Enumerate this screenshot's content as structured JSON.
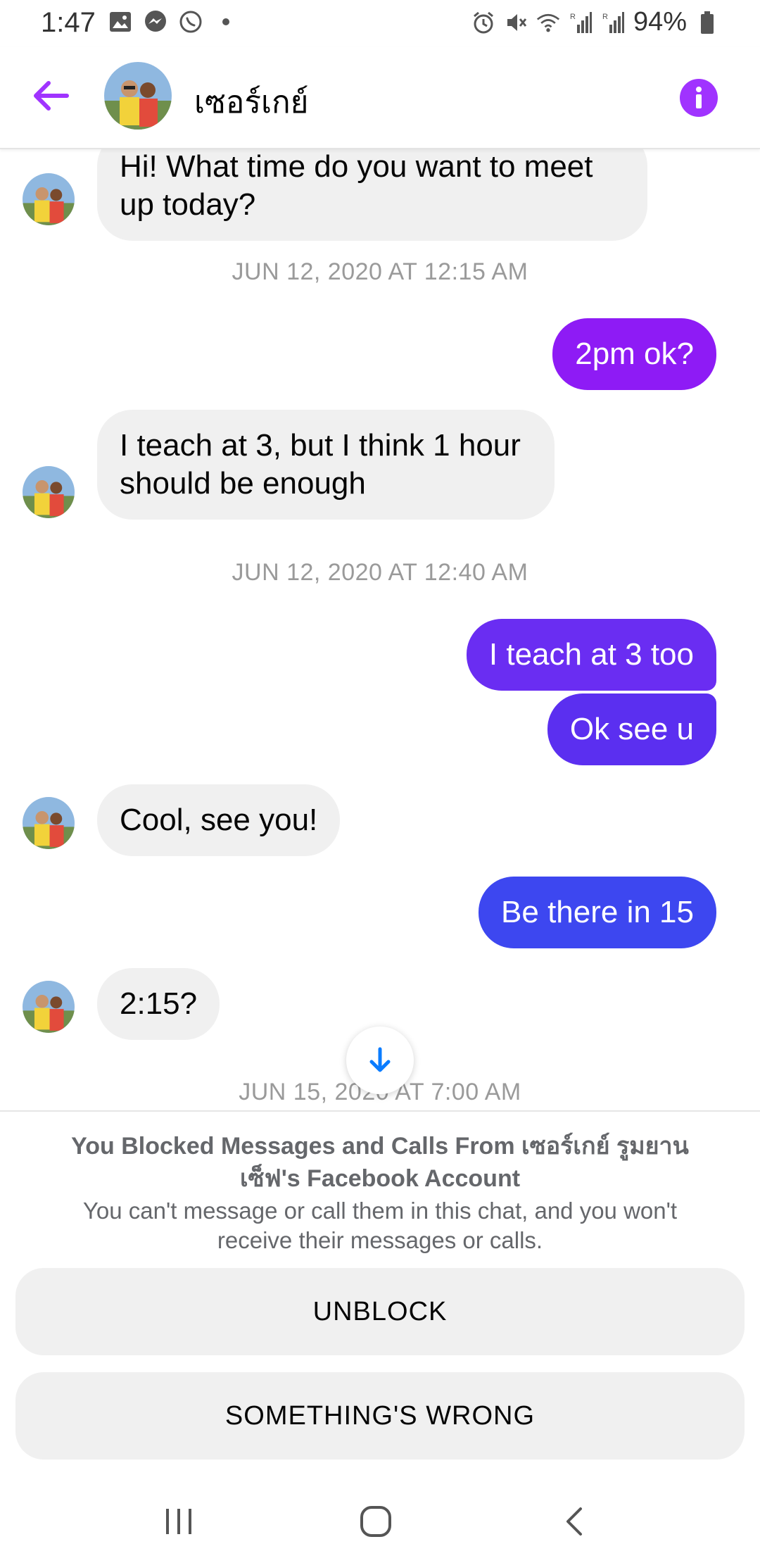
{
  "status_bar": {
    "time": "1:47",
    "battery": "94%",
    "left_icons": [
      "image-icon",
      "messenger-icon",
      "whatsapp-icon",
      "dot-icon"
    ],
    "right_icons": [
      "alarm-icon",
      "mute-icon",
      "wifi-icon",
      "signal-r-icon",
      "signal-r-icon",
      "battery-icon"
    ]
  },
  "header": {
    "contact_name": "เซอร์เกย์",
    "back_icon": "back-arrow-icon",
    "info_icon": "info-icon",
    "accent_color": "#a033ff"
  },
  "messages": [
    {
      "dir": "in",
      "text_lines": [
        "Hi! What time do you want to meet",
        "up today?"
      ]
    },
    {
      "timestamp": "JUN 12, 2020 AT 12:15 AM"
    },
    {
      "dir": "out",
      "text": "2pm ok?",
      "color": "#8e1bf5"
    },
    {
      "dir": "in",
      "text_lines": [
        "I teach at 3, but I think 1 hour",
        "should be enough"
      ]
    },
    {
      "timestamp": "JUN 12, 2020 AT 12:40 AM"
    },
    {
      "dir": "out",
      "text": "I teach at 3 too",
      "color": "#6a2df2"
    },
    {
      "dir": "out",
      "text": "Ok see u",
      "color": "#5b2ff0"
    },
    {
      "dir": "in",
      "text": "Cool, see you!"
    },
    {
      "dir": "out",
      "text": "Be there in 15",
      "color": "#3d47f0"
    },
    {
      "dir": "in",
      "text": "2:15?"
    },
    {
      "timestamp": "JUN 15, 2020 AT 7:00 AM"
    }
  ],
  "blocked_panel": {
    "title_line1": "You Blocked Messages and Calls From เซอร์เกย์ รูมยาน",
    "title_line2": "เซ็ฟ's Facebook Account",
    "desc_line1": "You can't message or call them in this chat, and you won't",
    "desc_line2": "receive their messages or calls.",
    "unblock_label": "UNBLOCK",
    "wrong_label": "SOMETHING'S WRONG"
  },
  "nav_bar": {
    "icons": [
      "recents-icon",
      "home-icon",
      "back-nav-icon"
    ]
  }
}
